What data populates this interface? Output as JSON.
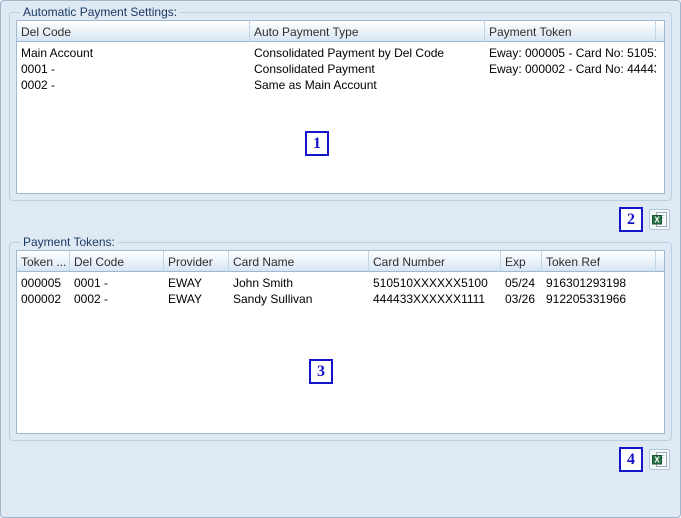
{
  "sections": [
    {
      "title": "Automatic Payment Settings:",
      "annotation": "1",
      "export_annotation": "2",
      "export_icon": "excel-export-icon",
      "table": {
        "columns": [
          "Del Code",
          "Auto Payment Type",
          "Payment Token"
        ],
        "rows": [
          [
            "Main Account",
            "Consolidated Payment by Del Code",
            "Eway: 000005 - Card No: 51051..."
          ],
          [
            "0001 -",
            "Consolidated Payment",
            "Eway: 000002 - Card No: 44443..."
          ],
          [
            "0002 -",
            "Same as Main Account",
            ""
          ]
        ]
      }
    },
    {
      "title": "Payment Tokens:",
      "annotation": "3",
      "export_annotation": "4",
      "export_icon": "excel-export-icon",
      "table": {
        "columns": [
          "Token ...",
          "Del Code",
          "Provider",
          "Card Name",
          "Card Number",
          "Exp",
          "Token Ref"
        ],
        "rows": [
          [
            "000005",
            "0001 -",
            "EWAY",
            "John Smith",
            "510510XXXXXX5100",
            "05/24",
            "916301293198"
          ],
          [
            "000002",
            "0002 -",
            "EWAY",
            "Sandy Sullivan",
            "444433XXXXXX1111",
            "03/26",
            "912205331966"
          ]
        ]
      }
    }
  ],
  "colors": {
    "background": "#dfe9f3",
    "annotation_blue": "#1414c8",
    "excel_green": "#217346"
  }
}
